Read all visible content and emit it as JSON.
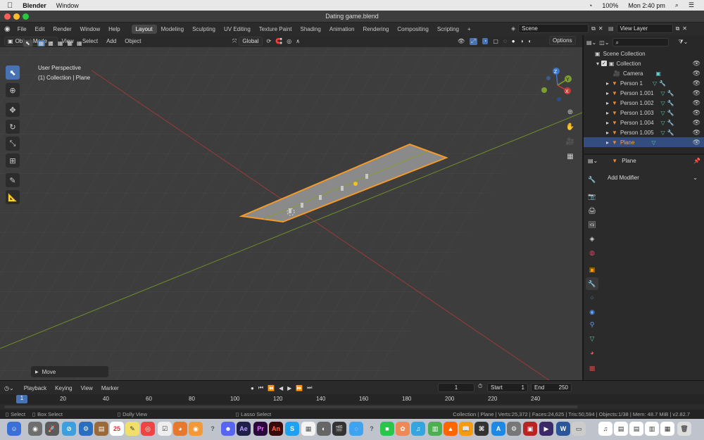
{
  "macbar": {
    "app": "Blender",
    "menu_window": "Window",
    "battery": "100%",
    "clock": "Mon 2:40 pm"
  },
  "window": {
    "title": "Dating game.blend"
  },
  "topbar": {
    "menus": [
      "File",
      "Edit",
      "Render",
      "Window",
      "Help"
    ],
    "workspaces": [
      "Layout",
      "Modeling",
      "Sculpting",
      "UV Editing",
      "Texture Paint",
      "Shading",
      "Animation",
      "Rendering",
      "Compositing",
      "Scripting"
    ],
    "active_workspace": "Layout",
    "scene": "Scene",
    "view_layer": "View Layer"
  },
  "viewport": {
    "mode": "Object Mode",
    "menus": [
      "View",
      "Select",
      "Add",
      "Object"
    ],
    "transform_orientation": "Global",
    "options": "Options",
    "info_line1": "User Perspective",
    "info_line2": "(1) Collection | Plane",
    "last_op": "Move",
    "gizmo": {
      "x": "X",
      "y": "Y",
      "z": "Z"
    }
  },
  "outliner": {
    "search_placeholder": "",
    "root": "Scene Collection",
    "collection": "Collection",
    "items": [
      {
        "name": "Camera",
        "selected": false
      },
      {
        "name": "Person 1",
        "selected": false
      },
      {
        "name": "Person 1.001",
        "selected": false
      },
      {
        "name": "Person 1.002",
        "selected": false
      },
      {
        "name": "Person 1.003",
        "selected": false
      },
      {
        "name": "Person 1.004",
        "selected": false
      },
      {
        "name": "Person 1.005",
        "selected": false
      },
      {
        "name": "Plane",
        "selected": true
      }
    ]
  },
  "properties": {
    "object": "Plane",
    "add_modifier": "Add Modifier"
  },
  "timeline": {
    "menus": [
      "Playback",
      "Keying",
      "View",
      "Marker"
    ],
    "current_frame": "1",
    "start_label": "Start",
    "start": "1",
    "end_label": "End",
    "end": "250",
    "ticks": [
      "1",
      "20",
      "40",
      "60",
      "80",
      "100",
      "120",
      "140",
      "160",
      "180",
      "200",
      "220",
      "240"
    ]
  },
  "statusbar": {
    "select": "Select",
    "box_select": "Box Select",
    "dolly": "Dolly View",
    "lasso": "Lasso Select",
    "stats": "Collection | Plane | Verts:25,372 | Faces:24,625 | Tris:50,594 | Objects:1/38 | Mem: 48.7 MiB | v2.82.7"
  },
  "colors": {
    "accent": "#4772b3",
    "selected_orange": "#ffa43b",
    "x_axis": "#c93a3a",
    "y_axis": "#78a02a"
  }
}
